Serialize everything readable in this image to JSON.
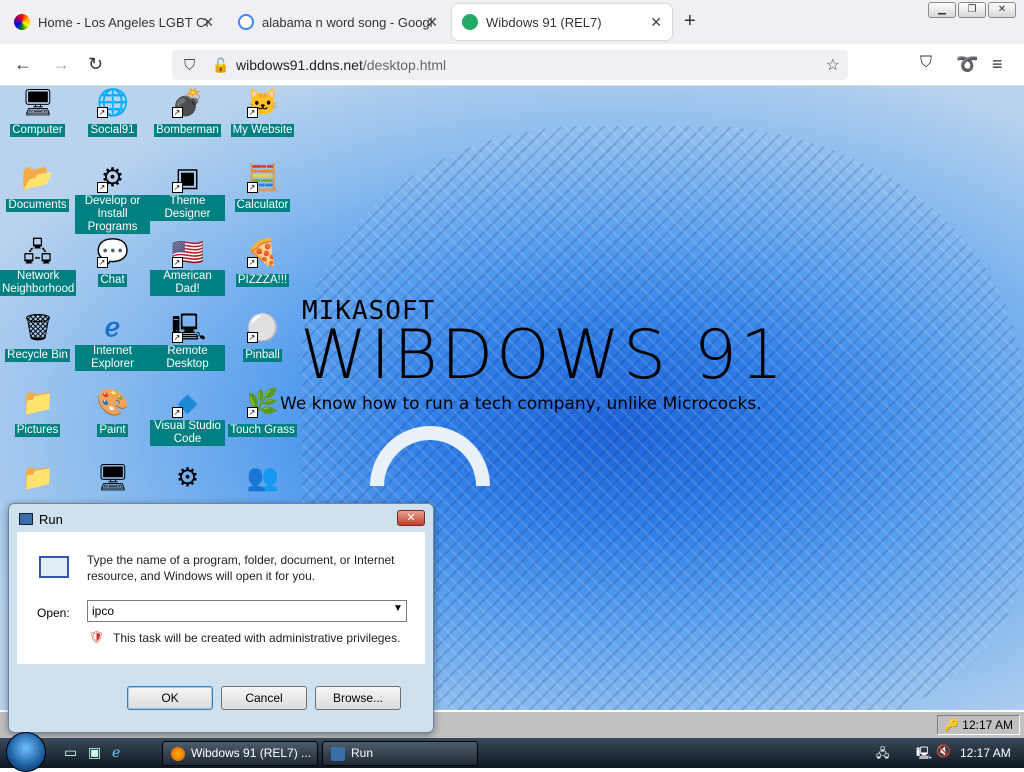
{
  "browser": {
    "tabs": [
      {
        "title": "Home - Los Angeles LGBT Cent",
        "active": false
      },
      {
        "title": "alabama n word song - Google",
        "active": false
      },
      {
        "title": "Wibdows 91 (REL7)",
        "active": true
      }
    ],
    "new_tab": "+",
    "url_host": "wibdows91.ddns.net",
    "url_path": "/desktop.html"
  },
  "desktop": {
    "icons": [
      {
        "label": "Computer",
        "glyph": "🖥"
      },
      {
        "label": "Social91",
        "glyph": "🌐"
      },
      {
        "label": "Bomberman",
        "glyph": "💣"
      },
      {
        "label": "My Website",
        "glyph": "🐱"
      },
      {
        "label": "Documents",
        "glyph": "📂"
      },
      {
        "label": "Develop or Install Programs",
        "glyph": "⚙"
      },
      {
        "label": "Theme Designer",
        "glyph": "▣"
      },
      {
        "label": "Calculator",
        "glyph": "🧮"
      },
      {
        "label": "Network Neighborhood",
        "glyph": "🖧"
      },
      {
        "label": "Chat",
        "glyph": "💬"
      },
      {
        "label": "American Dad!",
        "glyph": "🇺🇸"
      },
      {
        "label": "PIZZZA!!!",
        "glyph": "🍕"
      },
      {
        "label": "Recycle Bin",
        "glyph": "🗑"
      },
      {
        "label": "Internet Explorer",
        "glyph": "ℯ"
      },
      {
        "label": "Remote Desktop",
        "glyph": "🖳"
      },
      {
        "label": "Pinball",
        "glyph": "⚪"
      },
      {
        "label": "Pictures",
        "glyph": "📁"
      },
      {
        "label": "Paint",
        "glyph": "🎨"
      },
      {
        "label": "Visual Studio Code",
        "glyph": "◆"
      },
      {
        "label": "Touch Grass",
        "glyph": "🌿"
      }
    ],
    "brand_small": "MIKASOFT",
    "brand_big": "WIBDOWS 91",
    "brand_tag": "We know how to run a tech company, unlike Micrococks.",
    "clock": "12:17 AM"
  },
  "run_dialog": {
    "title": "Run",
    "close": "✕",
    "description": "Type the name of a program, folder, document, or Internet resource, and Windows will open it for you.",
    "open_label": "Open:",
    "open_value": "ipco",
    "admin_note": "This task will be created with administrative privileges.",
    "ok": "OK",
    "cancel": "Cancel",
    "browse": "Browse..."
  },
  "taskbar": {
    "buttons": [
      {
        "label": "Wibdows 91 (REL7) ...",
        "icon": "firefox-icon"
      },
      {
        "label": "Run",
        "icon": "run-icon"
      }
    ],
    "clock": "12:17 AM"
  }
}
